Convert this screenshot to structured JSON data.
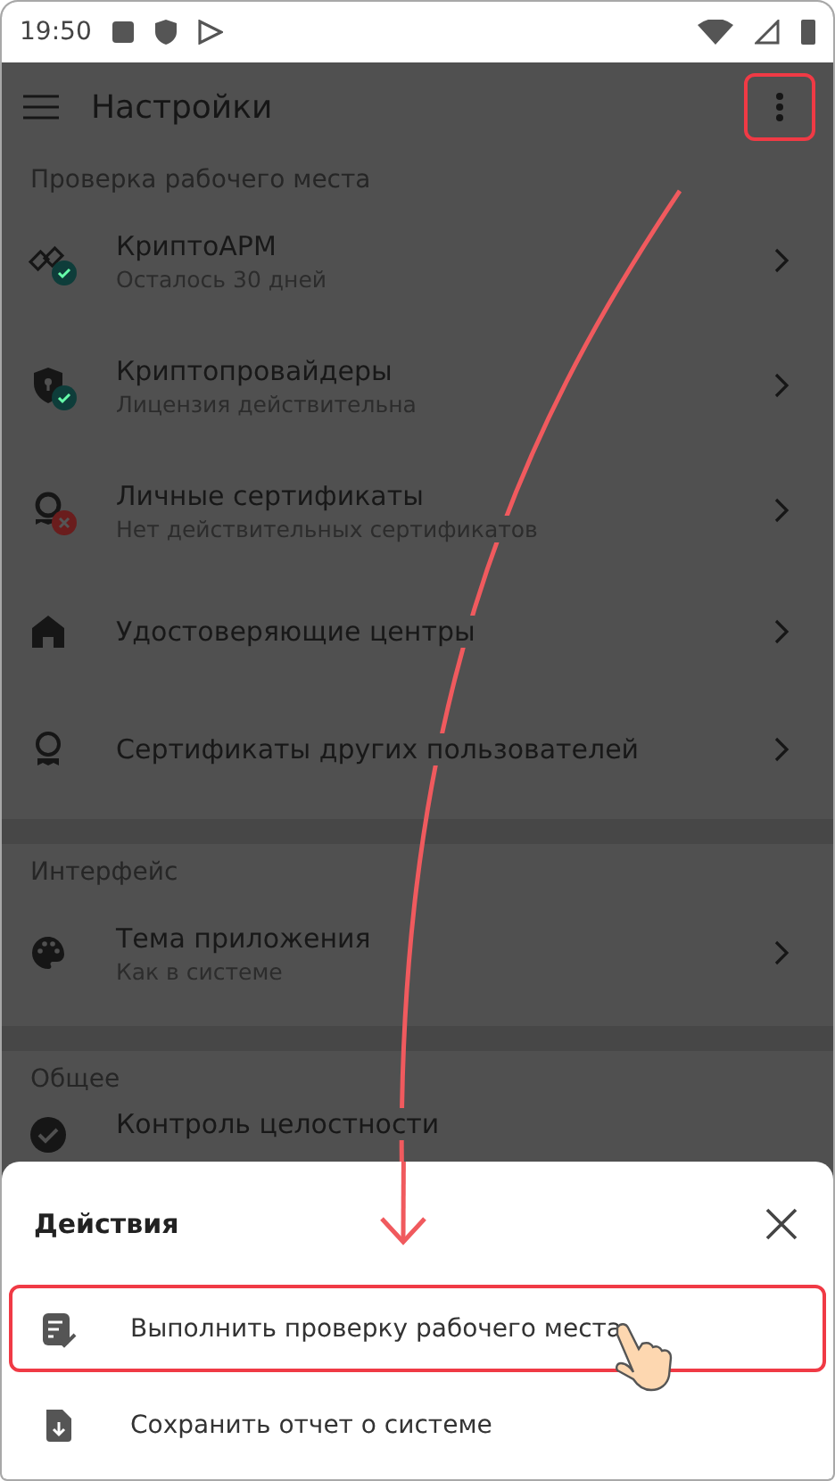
{
  "status_bar": {
    "time": "19:50"
  },
  "app_bar": {
    "title": "Настройки",
    "menu_highlighted": true
  },
  "sections": [
    {
      "title": "Проверка рабочего места",
      "items": [
        {
          "kind": "link",
          "title": "КриптоАРМ",
          "subtitle": "Осталось 30 дней",
          "valid": true
        },
        {
          "kind": "shield",
          "title": "Криптопровайдеры",
          "subtitle": "Лицензия действительна",
          "valid": true
        },
        {
          "kind": "certificate",
          "title": "Личные сертификаты",
          "subtitle": "Нет действительных сертификатов",
          "valid": false
        },
        {
          "kind": "house",
          "title": "Удостоверяющие центры"
        },
        {
          "kind": "award",
          "title": "Сертификаты других пользователей"
        }
      ]
    },
    {
      "title": "Интерфейс",
      "items": [
        {
          "kind": "palette",
          "title": "Тема приложения",
          "subtitle": "Как в системе"
        }
      ]
    },
    {
      "title": "Общее",
      "items": [
        {
          "kind": "check",
          "title": "Контроль целостности"
        }
      ]
    }
  ],
  "sheet": {
    "title": "Действия",
    "actions": [
      {
        "kind": "checklist",
        "label": "Выполнить проверку рабочего места",
        "highlighted": true
      },
      {
        "kind": "file",
        "label": "Сохранить отчет о системе",
        "highlighted": false
      }
    ]
  }
}
